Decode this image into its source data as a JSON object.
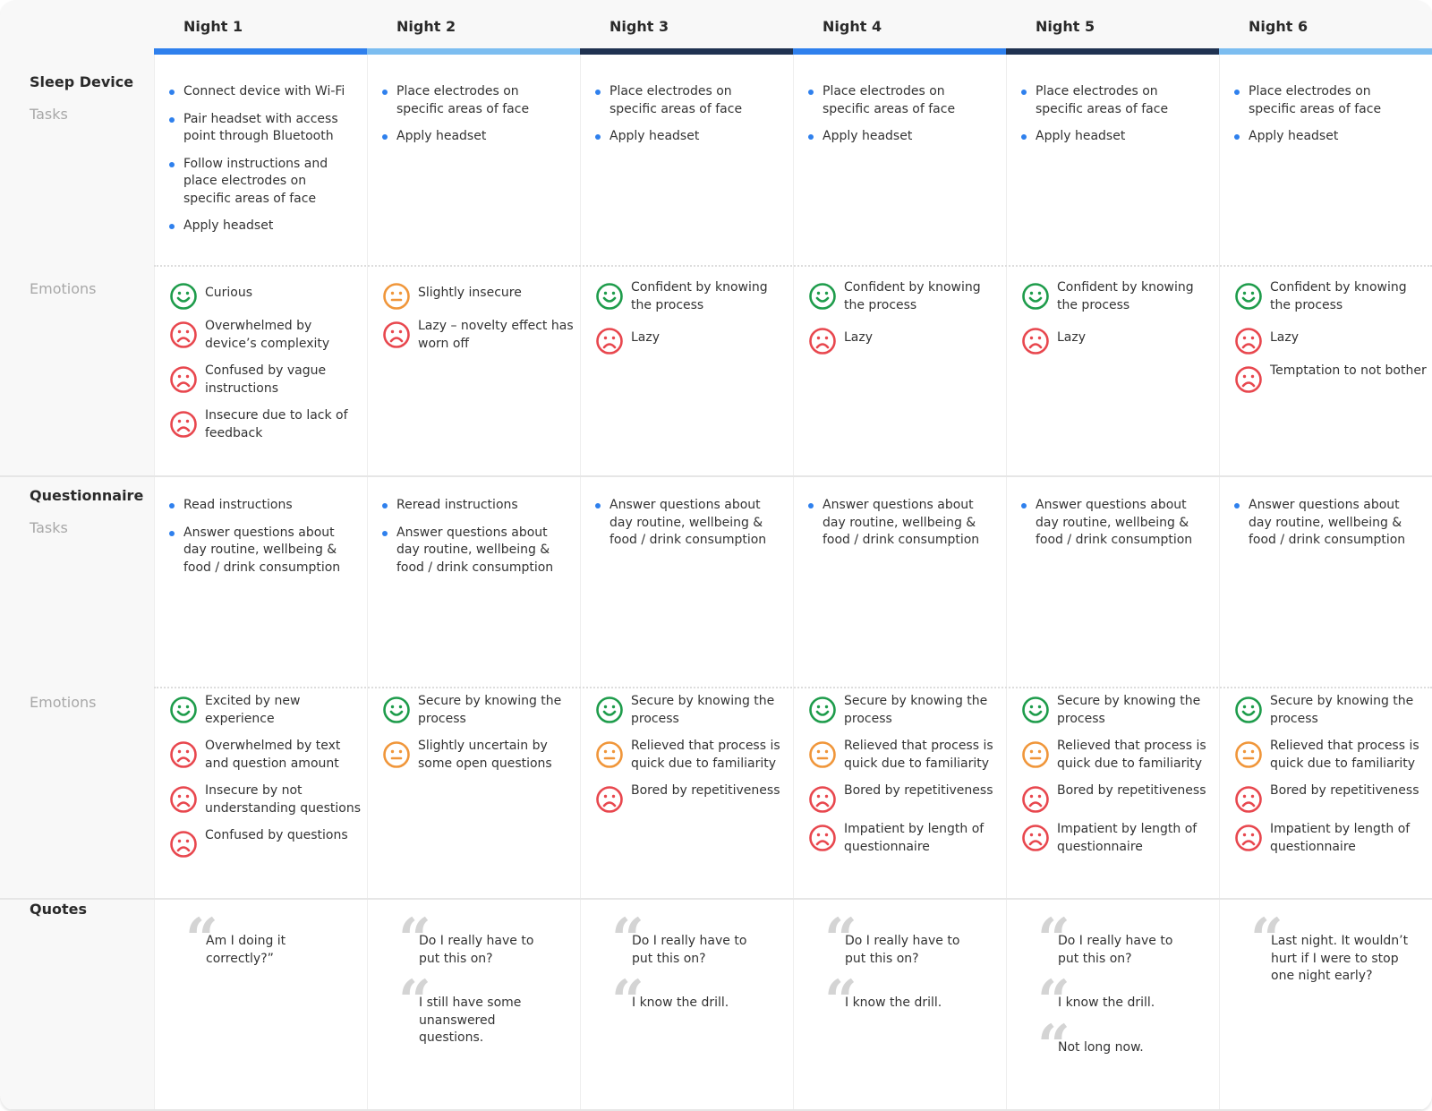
{
  "nights": [
    {
      "label": "Night 1",
      "bar_color": "#2f80ed"
    },
    {
      "label": "Night 2",
      "bar_color": "#7cbdf0"
    },
    {
      "label": "Night 3",
      "bar_color": "#1f3251"
    },
    {
      "label": "Night 4",
      "bar_color": "#2f80ed"
    },
    {
      "label": "Night 5",
      "bar_color": "#1f3251"
    },
    {
      "label": "Night 6",
      "bar_color": "#7cbdf0"
    }
  ],
  "colors": {
    "bullet": "#2f80ed",
    "positive": "#1e9c4b",
    "neutral": "#f0963a",
    "negative": "#e8474e",
    "quote_mark": "#d4d4d4"
  },
  "rows": {
    "sleep_device": {
      "title": "Sleep Device",
      "subtitle": "Tasks"
    },
    "sleep_emotions": {
      "title": "Emotions"
    },
    "questionnaire": {
      "title": "Questionnaire",
      "subtitle": "Tasks"
    },
    "questionnaire_emotions": {
      "title": "Emotions"
    },
    "quotes": {
      "title": "Quotes"
    }
  },
  "sleep_device_tasks": [
    [
      "Connect device with Wi-Fi",
      "Pair headset with access point through Bluetooth",
      "Follow instructions and place electrodes on specific areas of face",
      "Apply headset"
    ],
    [
      "Place electrodes on specific areas of face",
      "Apply headset"
    ],
    [
      "Place electrodes on specific areas of face",
      "Apply headset"
    ],
    [
      "Place electrodes on specific areas of face",
      "Apply headset"
    ],
    [
      "Place electrodes on specific areas of face",
      "Apply headset"
    ],
    [
      "Place electrodes on specific areas of face",
      "Apply headset"
    ]
  ],
  "sleep_device_emotions": [
    [
      {
        "mood": "positive",
        "icon": "happy-face-icon",
        "text": "Curious"
      },
      {
        "mood": "negative",
        "icon": "sad-face-icon",
        "text": "Overwhelmed by device’s complexity"
      },
      {
        "mood": "negative",
        "icon": "sad-face-icon",
        "text": "Confused by vague instructions"
      },
      {
        "mood": "negative",
        "icon": "sad-face-icon",
        "text": "Insecure due to lack of feedback"
      }
    ],
    [
      {
        "mood": "neutral",
        "icon": "neutral-face-icon",
        "text": "Slightly insecure"
      },
      {
        "mood": "negative",
        "icon": "sad-face-icon",
        "text": "Lazy – novelty effect has worn off"
      }
    ],
    [
      {
        "mood": "positive",
        "icon": "happy-face-icon",
        "text": "Confident by knowing the process"
      },
      {
        "mood": "negative",
        "icon": "sad-face-icon",
        "text": "Lazy"
      }
    ],
    [
      {
        "mood": "positive",
        "icon": "happy-face-icon",
        "text": "Confident by knowing the process"
      },
      {
        "mood": "negative",
        "icon": "sad-face-icon",
        "text": "Lazy"
      }
    ],
    [
      {
        "mood": "positive",
        "icon": "happy-face-icon",
        "text": "Confident by knowing the process"
      },
      {
        "mood": "negative",
        "icon": "sad-face-icon",
        "text": "Lazy"
      }
    ],
    [
      {
        "mood": "positive",
        "icon": "happy-face-icon",
        "text": "Confident by knowing the process"
      },
      {
        "mood": "negative",
        "icon": "sad-face-icon",
        "text": "Lazy"
      },
      {
        "mood": "negative",
        "icon": "sad-face-icon",
        "text": "Temptation to not bother"
      }
    ]
  ],
  "questionnaire_tasks": [
    [
      "Read instructions",
      "Answer questions about day routine, wellbeing & food / drink consumption"
    ],
    [
      "Reread instructions",
      "Answer questions about day routine, wellbeing & food / drink consumption"
    ],
    [
      "Answer questions about day routine, wellbeing & food / drink consumption"
    ],
    [
      "Answer questions about day routine, wellbeing & food / drink consumption"
    ],
    [
      "Answer questions about day routine, wellbeing & food / drink consumption"
    ],
    [
      "Answer questions about day routine, wellbeing & food / drink consumption"
    ]
  ],
  "questionnaire_emotions": [
    [
      {
        "mood": "positive",
        "icon": "happy-face-icon",
        "text": "Excited by new experience"
      },
      {
        "mood": "negative",
        "icon": "sad-face-icon",
        "text": "Overwhelmed by text and question amount"
      },
      {
        "mood": "negative",
        "icon": "sad-face-icon",
        "text": "Insecure by not understanding questions"
      },
      {
        "mood": "negative",
        "icon": "sad-face-icon",
        "text": "Confused by questions"
      }
    ],
    [
      {
        "mood": "positive",
        "icon": "happy-face-icon",
        "text": "Secure by knowing the process"
      },
      {
        "mood": "neutral",
        "icon": "neutral-face-icon",
        "text": "Slightly uncertain by some open questions"
      }
    ],
    [
      {
        "mood": "positive",
        "icon": "happy-face-icon",
        "text": "Secure by knowing the process"
      },
      {
        "mood": "neutral",
        "icon": "neutral-face-icon",
        "text": "Relieved that process is quick due to familiarity"
      },
      {
        "mood": "negative",
        "icon": "sad-face-icon",
        "text": "Bored by repetitiveness"
      }
    ],
    [
      {
        "mood": "positive",
        "icon": "happy-face-icon",
        "text": "Secure by knowing the process"
      },
      {
        "mood": "neutral",
        "icon": "neutral-face-icon",
        "text": "Relieved that process is quick due to familiarity"
      },
      {
        "mood": "negative",
        "icon": "sad-face-icon",
        "text": "Bored by repetitiveness"
      },
      {
        "mood": "negative",
        "icon": "sad-face-icon",
        "text": "Impatient by length of questionnaire"
      }
    ],
    [
      {
        "mood": "positive",
        "icon": "happy-face-icon",
        "text": "Secure by knowing the process"
      },
      {
        "mood": "neutral",
        "icon": "neutral-face-icon",
        "text": "Relieved that process is quick due to familiarity"
      },
      {
        "mood": "negative",
        "icon": "sad-face-icon",
        "text": "Bored by repetitiveness"
      },
      {
        "mood": "negative",
        "icon": "sad-face-icon",
        "text": "Impatient by length of questionnaire"
      }
    ],
    [
      {
        "mood": "positive",
        "icon": "happy-face-icon",
        "text": "Secure by knowing the process"
      },
      {
        "mood": "neutral",
        "icon": "neutral-face-icon",
        "text": "Relieved that process is quick due to familiarity"
      },
      {
        "mood": "negative",
        "icon": "sad-face-icon",
        "text": "Bored by repetitiveness"
      },
      {
        "mood": "negative",
        "icon": "sad-face-icon",
        "text": "Impatient by length of questionnaire"
      }
    ]
  ],
  "quotes": [
    [
      "Am I doing it correctly?”"
    ],
    [
      "Do I really have to put this on?",
      "I still have some unanswered questions."
    ],
    [
      "Do I really have to put this on?",
      "I know the drill."
    ],
    [
      "Do I really have to put this on?",
      "I know the drill."
    ],
    [
      "Do I really have to put this on?",
      "I know the drill.",
      "Not long now."
    ],
    [
      "Last night. It wouldn’t hurt if I were to stop one night early?"
    ]
  ]
}
